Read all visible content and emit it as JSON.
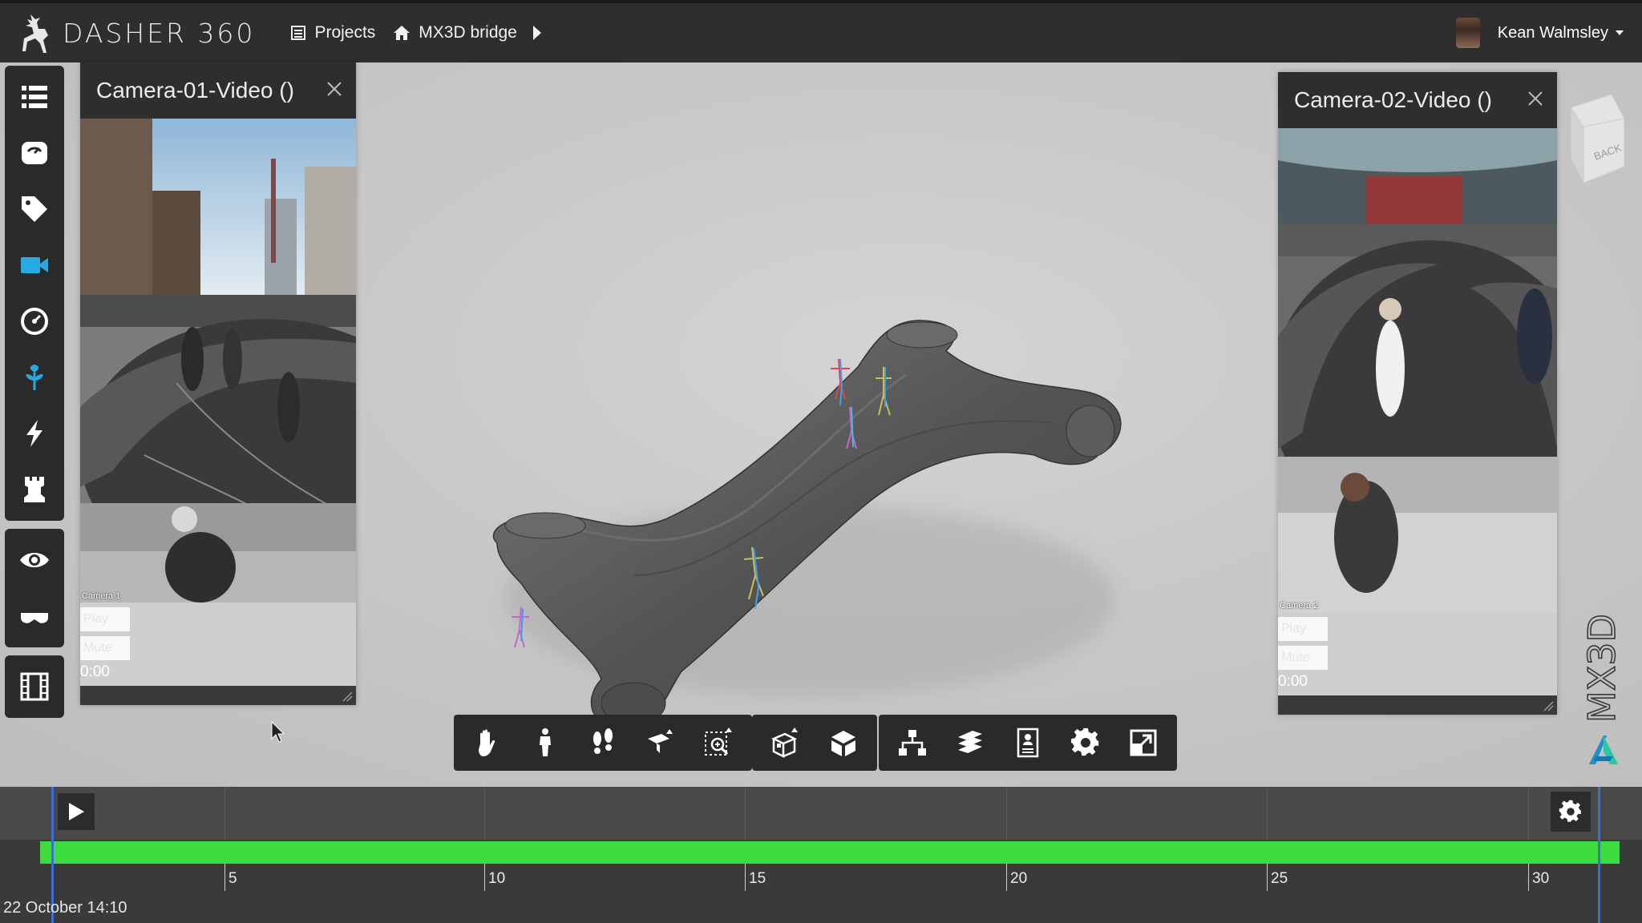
{
  "app": {
    "name": "DASHER 360"
  },
  "breadcrumbs": [
    {
      "label": "Projects",
      "icon": "list-icon"
    },
    {
      "label": "MX3D bridge",
      "icon": "home-icon"
    }
  ],
  "user": {
    "name": "Kean Walmsley"
  },
  "left_toolbar": {
    "groups": [
      [
        "list-icon",
        "sensor-icon",
        "tag-icon",
        "video-camera-icon",
        "gauge-icon",
        "plant-icon",
        "lightning-icon",
        "chess-rook-icon"
      ],
      [
        "eye-icon",
        "glasses-icon"
      ],
      [
        "film-icon"
      ]
    ]
  },
  "video_panels": [
    {
      "title": "Camera-01-Video ()",
      "camera_label": "Camera 1",
      "play_label": "Play",
      "mute_label": "Mute",
      "time": "0:00"
    },
    {
      "title": "Camera-02-Video ()",
      "camera_label": "Camera 2",
      "play_label": "Play",
      "mute_label": "Mute",
      "time": "0:00"
    }
  ],
  "bottom_toolbar": {
    "group1": [
      "pan-hand-icon",
      "walk-person-icon",
      "footprints-icon",
      "camera-views-icon",
      "zoom-select-icon"
    ],
    "group2": [
      "explode-box-icon",
      "cube-section-icon"
    ],
    "group3": [
      "model-tree-icon",
      "layers-icon",
      "properties-icon",
      "settings-gear-icon",
      "fullscreen-icon"
    ]
  },
  "view_cube": {
    "label": "BACK"
  },
  "watermark": {
    "text": "MX3D"
  },
  "timeline": {
    "ticks": [
      "5",
      "10",
      "15",
      "20",
      "25",
      "30"
    ],
    "date": "22 October 14:10",
    "bar_color": "#3cdc3c",
    "playhead_color": "#3b6fd6"
  },
  "colors": {
    "accent": "#27a9e1",
    "topbar": "#2e2e2e",
    "toolbar": "#2a2a2a"
  }
}
